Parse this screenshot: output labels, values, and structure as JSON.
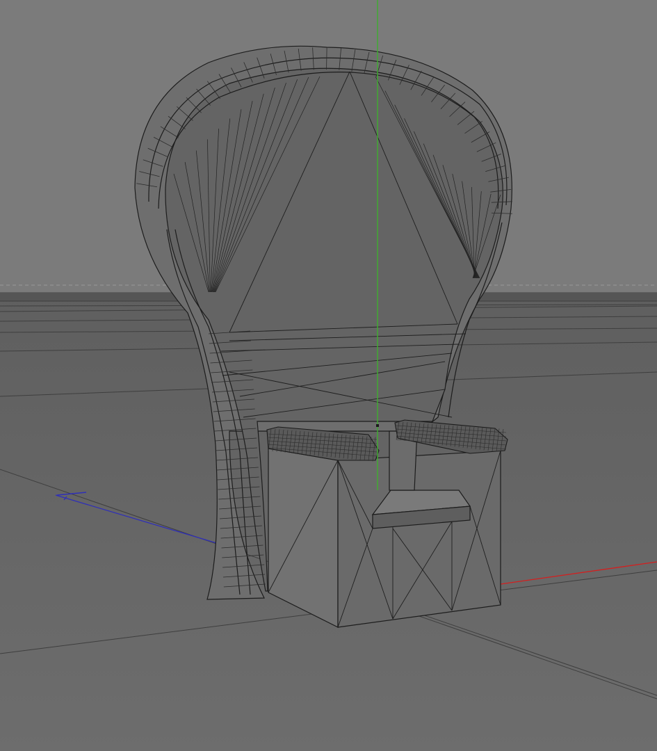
{
  "viewport": {
    "background_sky": "#7b7b7b",
    "background_floor": "#666666",
    "wire_color": "#1c1c1c",
    "model_fill": "#6f6f6f",
    "model_fill_dark": "#646464",
    "axis_colors": {
      "x": "#d41f1f",
      "y": "#3fae2f",
      "z": "#2f2fb8"
    }
  },
  "model": {
    "object_name": "",
    "type": "peacock-chair"
  }
}
